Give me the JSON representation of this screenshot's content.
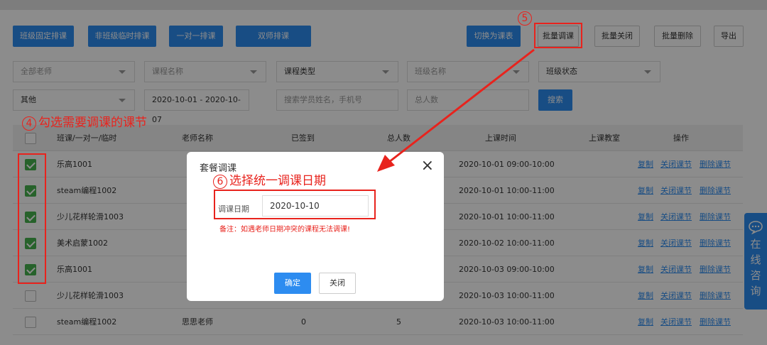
{
  "toolbar": {
    "left_buttons": [
      "班级固定排课",
      "非班级临时排课",
      "一对一排课",
      "双师排课"
    ],
    "switch_view": "切换为课表",
    "batch_adjust": "批量调课",
    "batch_close": "批量关闭",
    "batch_delete": "批量删除",
    "export": "导出"
  },
  "filters": {
    "teacher": "全部老师",
    "course_name": "课程名称",
    "course_type": "课程类型",
    "class_name": "班级名称",
    "class_status": "班级状态",
    "other": "其他",
    "date_range": "2020-10-01 - 2020-10-07",
    "student_placeholder": "搜索学员姓名，手机号",
    "total_placeholder": "总人数",
    "search_button": "搜索"
  },
  "table": {
    "headers": [
      "班课/一对一/临时",
      "老师名称",
      "已签到",
      "总人数",
      "上课时间",
      "上课教室",
      "操作"
    ],
    "actions": [
      "复制",
      "关闭课节",
      "删除课节"
    ],
    "rows": [
      {
        "name": "乐高1001",
        "teacher": "",
        "signed": "",
        "total": "",
        "time": "2020-10-01 09:00-10:00",
        "checked": true
      },
      {
        "name": "steam编程1002",
        "teacher": "",
        "signed": "",
        "total": "",
        "time": "2020-10-01 10:00-11:00",
        "checked": true
      },
      {
        "name": "少儿花样轮滑1003",
        "teacher": "",
        "signed": "",
        "total": "",
        "time": "2020-10-01 10:00-11:00",
        "checked": true
      },
      {
        "name": "美术启蒙1002",
        "teacher": "",
        "signed": "",
        "total": "",
        "time": "2020-10-02 10:00-11:00",
        "checked": true
      },
      {
        "name": "乐高1001",
        "teacher": "",
        "signed": "",
        "total": "",
        "time": "2020-10-03 09:00-10:00",
        "checked": true
      },
      {
        "name": "少儿花样轮滑1003",
        "teacher": "",
        "signed": "",
        "total": "",
        "time": "2020-10-03 10:00-11:00",
        "checked": false
      },
      {
        "name": "steam编程1002",
        "teacher": "思思老师",
        "signed": "0",
        "total": "5",
        "time": "2020-10-03 10:00-11:00",
        "checked": false
      }
    ]
  },
  "modal": {
    "title": "套餐调课",
    "date_label": "调课日期",
    "date_value": "2020-10-10",
    "note": "备注：如遇老师日期冲突的课程无法调课!",
    "confirm": "确定",
    "close": "关闭",
    "close_icon": "×"
  },
  "annotations": {
    "step4_num": "4",
    "step4_text": "勾选需要调课的课节",
    "step5_num": "5",
    "step6_num": "6",
    "step6_text": "选择统一调课日期",
    "color": "#e8231d"
  },
  "side_tab": {
    "icon": "chat-icon",
    "chars": [
      "在",
      "线",
      "咨",
      "询"
    ]
  }
}
